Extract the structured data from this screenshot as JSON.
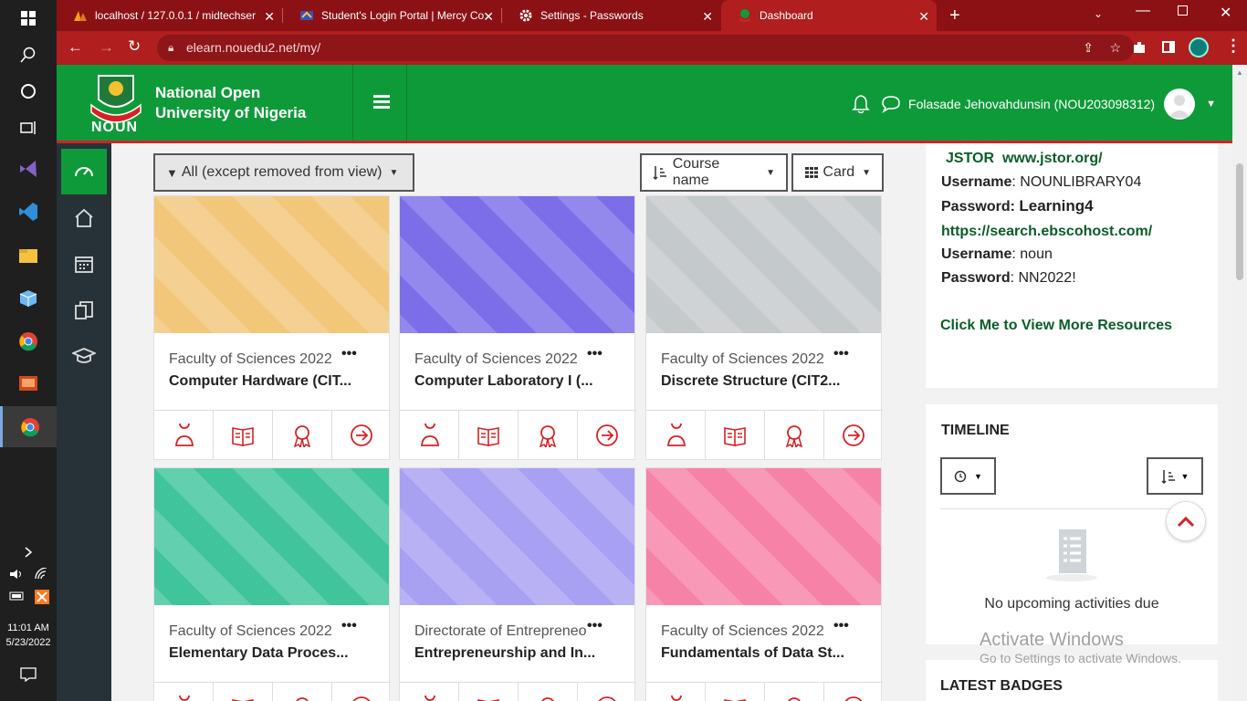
{
  "taskbar": {
    "time": "11:01 AM",
    "date": "5/23/2022",
    "icons": [
      "windows-icon",
      "search-icon",
      "cortana-icon",
      "task-view-icon",
      "visual-studio-icon",
      "vscode-icon",
      "file-explorer-icon",
      "box-icon",
      "chrome-icon",
      "presentation-icon",
      "chrome-active-icon"
    ]
  },
  "browser": {
    "tabs": [
      {
        "title": "localhost / 127.0.0.1 / midtechser",
        "icon": "phpmyadmin-icon"
      },
      {
        "title": "Student's Login Portal | Mercy Co",
        "icon": "portal-icon"
      },
      {
        "title": "Settings - Passwords",
        "icon": "settings-icon"
      },
      {
        "title": "Dashboard",
        "icon": "noun-icon",
        "active": true
      }
    ],
    "url": "elearn.nouedu2.net/my/",
    "colors": {
      "tabstrip": "#8b1114",
      "toolbar": "#b01e1e"
    }
  },
  "header": {
    "logo_word": "NOUN",
    "name_line1": "National Open",
    "name_line2": "University of Nigeria",
    "user_name": "Folasade Jehovahdunsin (NOU203098312)",
    "colors": {
      "brand": "#0f9a3a",
      "accent": "#d32226"
    }
  },
  "sidebar": {
    "items": [
      "dashboard-icon",
      "home-icon",
      "calendar-icon",
      "files-icon",
      "courses-icon"
    ]
  },
  "filters": {
    "grouping": "All (except removed from view)",
    "sort": "Course name",
    "view": "Card"
  },
  "courses": [
    {
      "category": "Faculty of Sciences 2022",
      "name": "Computer Hardware (CIT...",
      "color": "#f2c77a"
    },
    {
      "category": "Faculty of Sciences 2022",
      "name": "Computer Laboratory I (...",
      "color": "#7b6ee8"
    },
    {
      "category": "Faculty of Sciences 2022",
      "name": "Discrete Structure (CIT2...",
      "color": "#c4c9cc"
    },
    {
      "category": "Faculty of Sciences 2022",
      "name": "Elementary Data Proces...",
      "color": "#3fc49c"
    },
    {
      "category": "Directorate of Entrepreneo",
      "name": "Entrepreneurship and In...",
      "color": "#a8a0f2"
    },
    {
      "category": "Faculty of Sciences 2022",
      "name": "Fundamentals of Data St...",
      "color": "#f782a8"
    }
  ],
  "resources": {
    "jstor_label": "JSTOR",
    "jstor_url": "www.jstor.org/",
    "username_label": "Username",
    "password_label": "Password:",
    "jstor_username": "NOUNLIBRARY04",
    "jstor_password": "Learning4",
    "ebsco_url": "https://search.ebscohost.com/",
    "ebsco_username": "noun",
    "ebsco_password": "NN2022!",
    "more_link": "Click Me to View More Resources"
  },
  "timeline": {
    "title": "TIMELINE",
    "empty_text": "No upcoming activities due"
  },
  "badges": {
    "title": "LATEST BADGES"
  },
  "watermark": {
    "line1": "Activate Windows",
    "line2": "Go to Settings to activate Windows."
  }
}
